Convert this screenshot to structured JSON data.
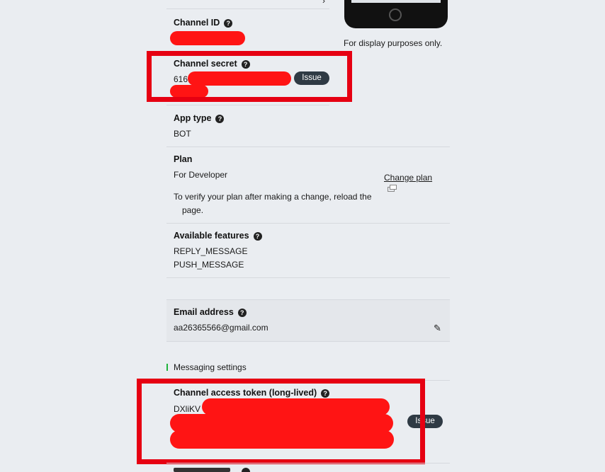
{
  "preview": {
    "caption": "For display purposes only."
  },
  "channel_id": {
    "label": "Channel ID",
    "help_icon": "question-circle-icon"
  },
  "channel_secret": {
    "label": "Channel secret",
    "value_prefix": "616",
    "issue_label": "Issue"
  },
  "app_type": {
    "label": "App type",
    "value": "BOT"
  },
  "plan": {
    "label": "Plan",
    "value": "For Developer",
    "change_label": "Change plan",
    "note_line1": "To verify your plan after making a change, reload the",
    "note_line2": "page."
  },
  "features": {
    "label": "Available features",
    "items": [
      "REPLY_MESSAGE",
      "PUSH_MESSAGE"
    ]
  },
  "email": {
    "label": "Email address",
    "value": "aa26365566@gmail.com",
    "edit_icon": "pencil-icon"
  },
  "messaging": {
    "section_label": "Messaging settings"
  },
  "access_token": {
    "label": "Channel access token (long-lived)",
    "value_prefix": "DXliKV",
    "issue_label": "Issue"
  },
  "colors": {
    "highlight": "#e60012",
    "redaction": "#ff1414",
    "accent_green": "#1fb33b",
    "pill": "#2f3a44"
  }
}
